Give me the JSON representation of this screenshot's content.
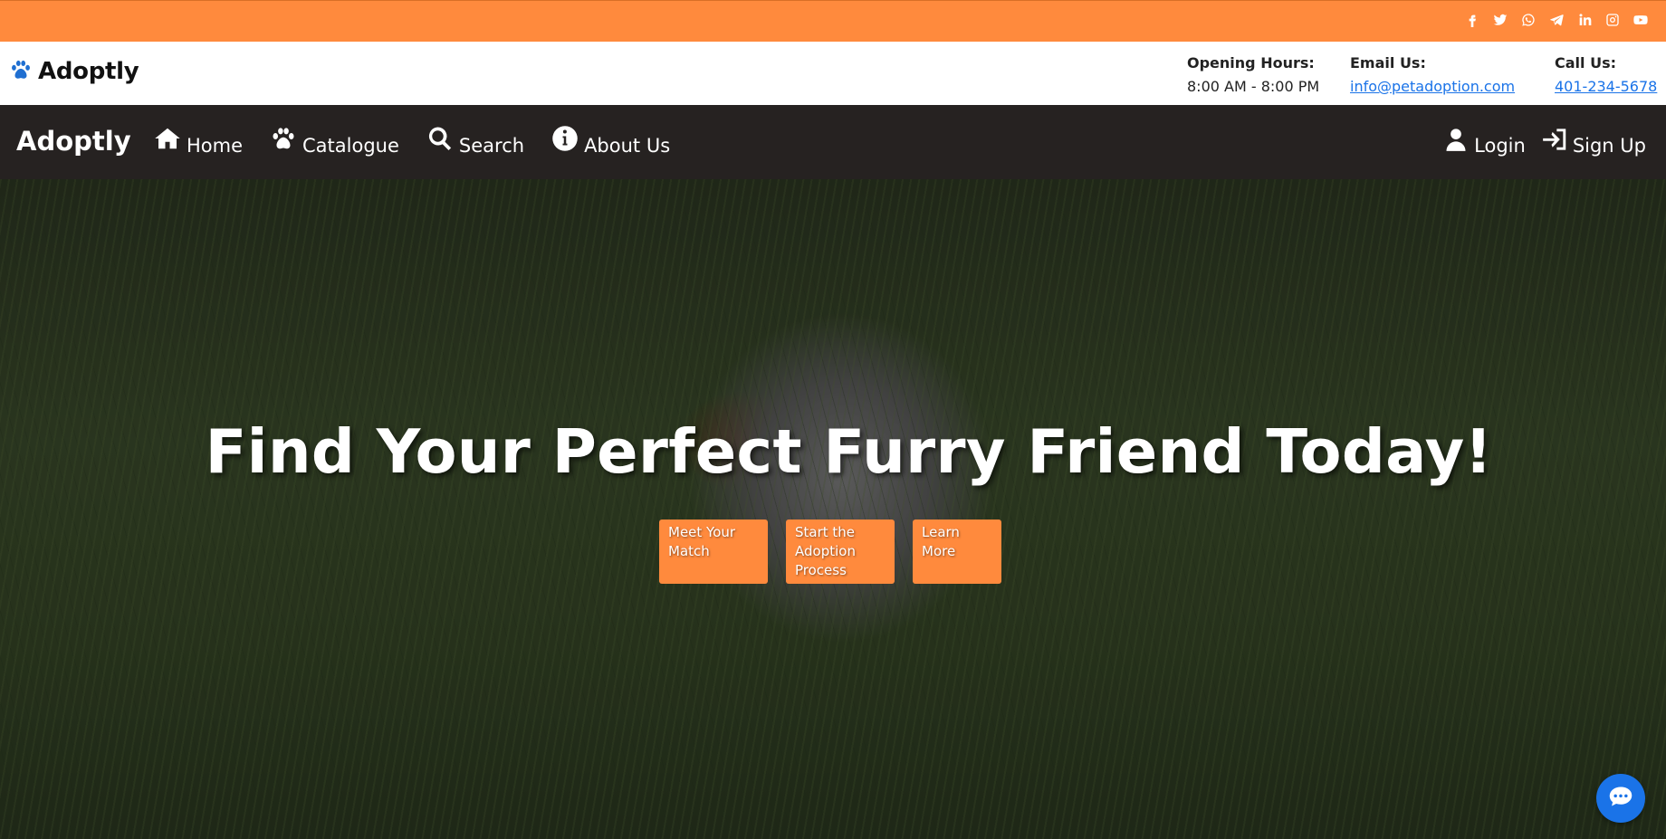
{
  "social": {
    "icons": [
      "facebook-icon",
      "twitter-icon",
      "whatsapp-icon",
      "telegram-icon",
      "linkedin-icon",
      "instagram-icon",
      "youtube-icon"
    ]
  },
  "header": {
    "brand": "Adoptly",
    "hours_label": "Opening Hours:",
    "hours_value": "8:00 AM - 8:00 PM",
    "email_label": "Email Us:",
    "email_value": "info@petadoption.com",
    "call_label": "Call Us:",
    "call_value": "401-234-5678"
  },
  "nav": {
    "brand": "Adoptly",
    "links": [
      {
        "label": "Home",
        "icon": "home-icon"
      },
      {
        "label": "Catalogue",
        "icon": "paw-icon"
      },
      {
        "label": "Search",
        "icon": "search-icon"
      },
      {
        "label": "About Us",
        "icon": "info-icon"
      }
    ],
    "login": "Login",
    "signup": "Sign Up"
  },
  "hero": {
    "title": "Find Your Perfect Furry Friend Today!",
    "buttons": [
      "Meet Your Match",
      "Start the Adoption Process",
      "Learn More"
    ]
  },
  "colors": {
    "accent": "#ff8a3d",
    "nav_bg": "#262221",
    "link": "#1a73e8"
  }
}
